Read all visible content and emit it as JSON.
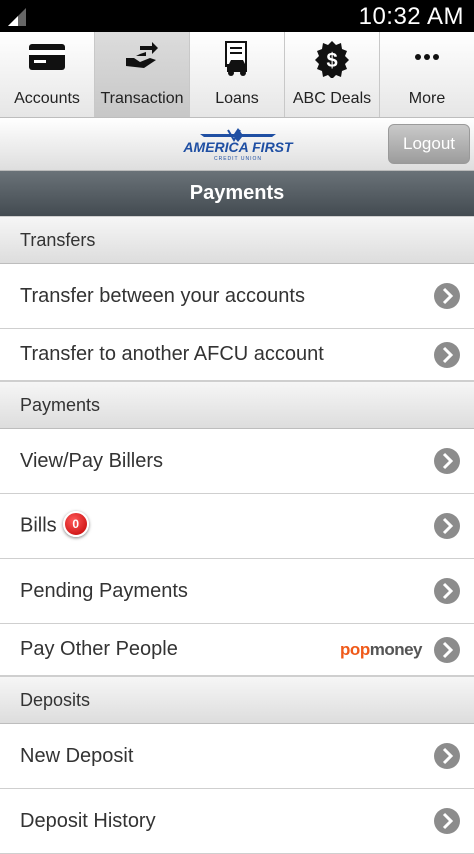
{
  "status": {
    "time": "10:32 AM"
  },
  "tabs": [
    {
      "label": "Accounts",
      "icon": "card-icon"
    },
    {
      "label": "Transaction",
      "icon": "transfer-icon",
      "active": true
    },
    {
      "label": "Loans",
      "icon": "loan-icon"
    },
    {
      "label": "ABC Deals",
      "icon": "dollar-icon"
    },
    {
      "label": "More",
      "icon": "more-icon"
    }
  ],
  "header": {
    "logo": "AMERICA FIRST",
    "logo_sub": "CREDIT UNION",
    "logout": "Logout"
  },
  "title": "Payments",
  "sections": {
    "transfers": {
      "label": "Transfers",
      "items": [
        "Transfer between your accounts",
        "Transfer to another AFCU account"
      ]
    },
    "payments": {
      "label": "Payments",
      "items": [
        "View/Pay Billers",
        "Bills",
        "Pending Payments",
        "Pay Other People"
      ],
      "bills_badge": "0",
      "popmoney_a": "pop",
      "popmoney_b": "money"
    },
    "deposits": {
      "label": "Deposits",
      "items": [
        "New Deposit",
        "Deposit History"
      ]
    }
  },
  "colors": {
    "accent_blue": "#1f4fa3",
    "badge_red": "#c00000",
    "popmoney_orange": "#ef5a1a"
  }
}
